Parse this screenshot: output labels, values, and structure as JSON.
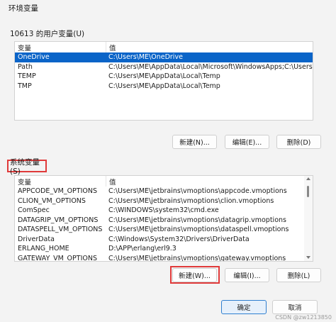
{
  "window": {
    "title": "环境变量"
  },
  "user_section": {
    "label": "10613 的用户变量(U)",
    "columns": [
      "变量",
      "值"
    ],
    "rows": [
      {
        "name": "OneDrive",
        "value": "C:\\Users\\ME\\OneDrive",
        "selected": true
      },
      {
        "name": "Path",
        "value": "C:\\Users\\ME\\AppData\\Local\\Microsoft\\WindowsApps;C:\\Users\\ME..."
      },
      {
        "name": "TEMP",
        "value": "C:\\Users\\ME\\AppData\\Local\\Temp"
      },
      {
        "name": "TMP",
        "value": "C:\\Users\\ME\\AppData\\Local\\Temp"
      }
    ],
    "buttons": {
      "new": "新建(N)...",
      "edit": "编辑(E)...",
      "delete": "删除(D)"
    }
  },
  "system_section": {
    "label": "系统变量(S)",
    "columns": [
      "变量",
      "值"
    ],
    "rows": [
      {
        "name": "APPCODE_VM_OPTIONS",
        "value": "C:\\Users\\ME\\jetbrains\\vmoptions\\appcode.vmoptions"
      },
      {
        "name": "CLION_VM_OPTIONS",
        "value": "C:\\Users\\ME\\jetbrains\\vmoptions\\clion.vmoptions"
      },
      {
        "name": "ComSpec",
        "value": "C:\\WINDOWS\\system32\\cmd.exe"
      },
      {
        "name": "DATAGRIP_VM_OPTIONS",
        "value": "C:\\Users\\ME\\jetbrains\\vmoptions\\datagrip.vmoptions"
      },
      {
        "name": "DATASPELL_VM_OPTIONS",
        "value": "C:\\Users\\ME\\jetbrains\\vmoptions\\dataspell.vmoptions"
      },
      {
        "name": "DriverData",
        "value": "C:\\Windows\\System32\\Drivers\\DriverData"
      },
      {
        "name": "ERLANG_HOME",
        "value": "D:\\APP\\erlang\\erl9.3"
      },
      {
        "name": "GATEWAY_VM_OPTIONS",
        "value": "C:\\Users\\ME\\jetbrains\\vmoptions\\gateway.vmoptions"
      }
    ],
    "buttons": {
      "new": "新建(W)...",
      "edit": "编辑(I)...",
      "delete": "删除(L)"
    }
  },
  "footer": {
    "ok": "确定",
    "cancel": "取消"
  },
  "watermark": "CSDN @zw1213850",
  "colors": {
    "selection": "#0a64c8",
    "highlight": "#e03a3a"
  }
}
